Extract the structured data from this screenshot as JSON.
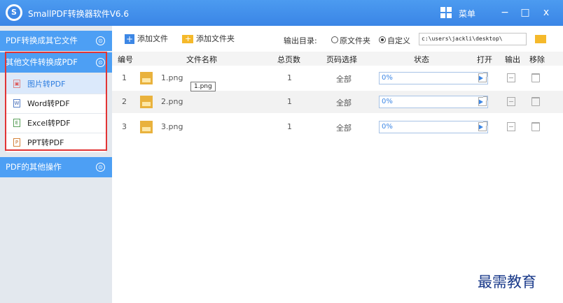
{
  "app": {
    "title": "SmallPDF转换器软件V6.6",
    "logo_letter": "S",
    "menu_label": "菜单",
    "win_min": "−",
    "win_max": "□",
    "win_close": "x"
  },
  "sidebar": {
    "section1": {
      "label": "PDF转换成其它文件",
      "icon": "chevron-down-icon",
      "expand": "⊙"
    },
    "section2": {
      "label": "其他文件转换成PDF",
      "icon": "chevron-up-icon",
      "expand": "⊙"
    },
    "items": [
      {
        "label": "图片转PDF",
        "icon": "image-file-icon",
        "glyph": "▣"
      },
      {
        "label": "Word转PDF",
        "icon": "word-file-icon",
        "glyph": "W"
      },
      {
        "label": "Excel转PDF",
        "icon": "excel-file-icon",
        "glyph": "E"
      },
      {
        "label": "PPT转PDF",
        "icon": "ppt-file-icon",
        "glyph": "P"
      }
    ],
    "section3": {
      "label": "PDF的其他操作",
      "icon": "chevron-down-icon",
      "expand": "⊙"
    }
  },
  "toolbar": {
    "add_file": "添加文件",
    "add_folder": "添加文件夹",
    "plus": "+",
    "output_label": "输出目录:",
    "opt_original": "原文件夹",
    "opt_custom": "自定义",
    "path": "c:\\users\\jackli\\desktop\\"
  },
  "table": {
    "headers": {
      "num": "编号",
      "name": "文件名称",
      "pages": "总页数",
      "page_sel": "页码选择",
      "status": "状态",
      "open": "打开",
      "output": "输出",
      "remove": "移除"
    },
    "rows": [
      {
        "num": "1",
        "name": "1.png",
        "pages": "1",
        "page_sel": "全部",
        "progress": "0%"
      },
      {
        "num": "2",
        "name": "2.png",
        "pages": "1",
        "page_sel": "全部",
        "progress": "0%"
      },
      {
        "num": "3",
        "name": "3.png",
        "pages": "1",
        "page_sel": "全部",
        "progress": "0%"
      }
    ],
    "tooltip": "1.png"
  },
  "watermark": "最需教育",
  "colors": {
    "accent": "#3d87e5",
    "highlight": "#e23535",
    "sidebar_bg": "#e3e8ee"
  }
}
